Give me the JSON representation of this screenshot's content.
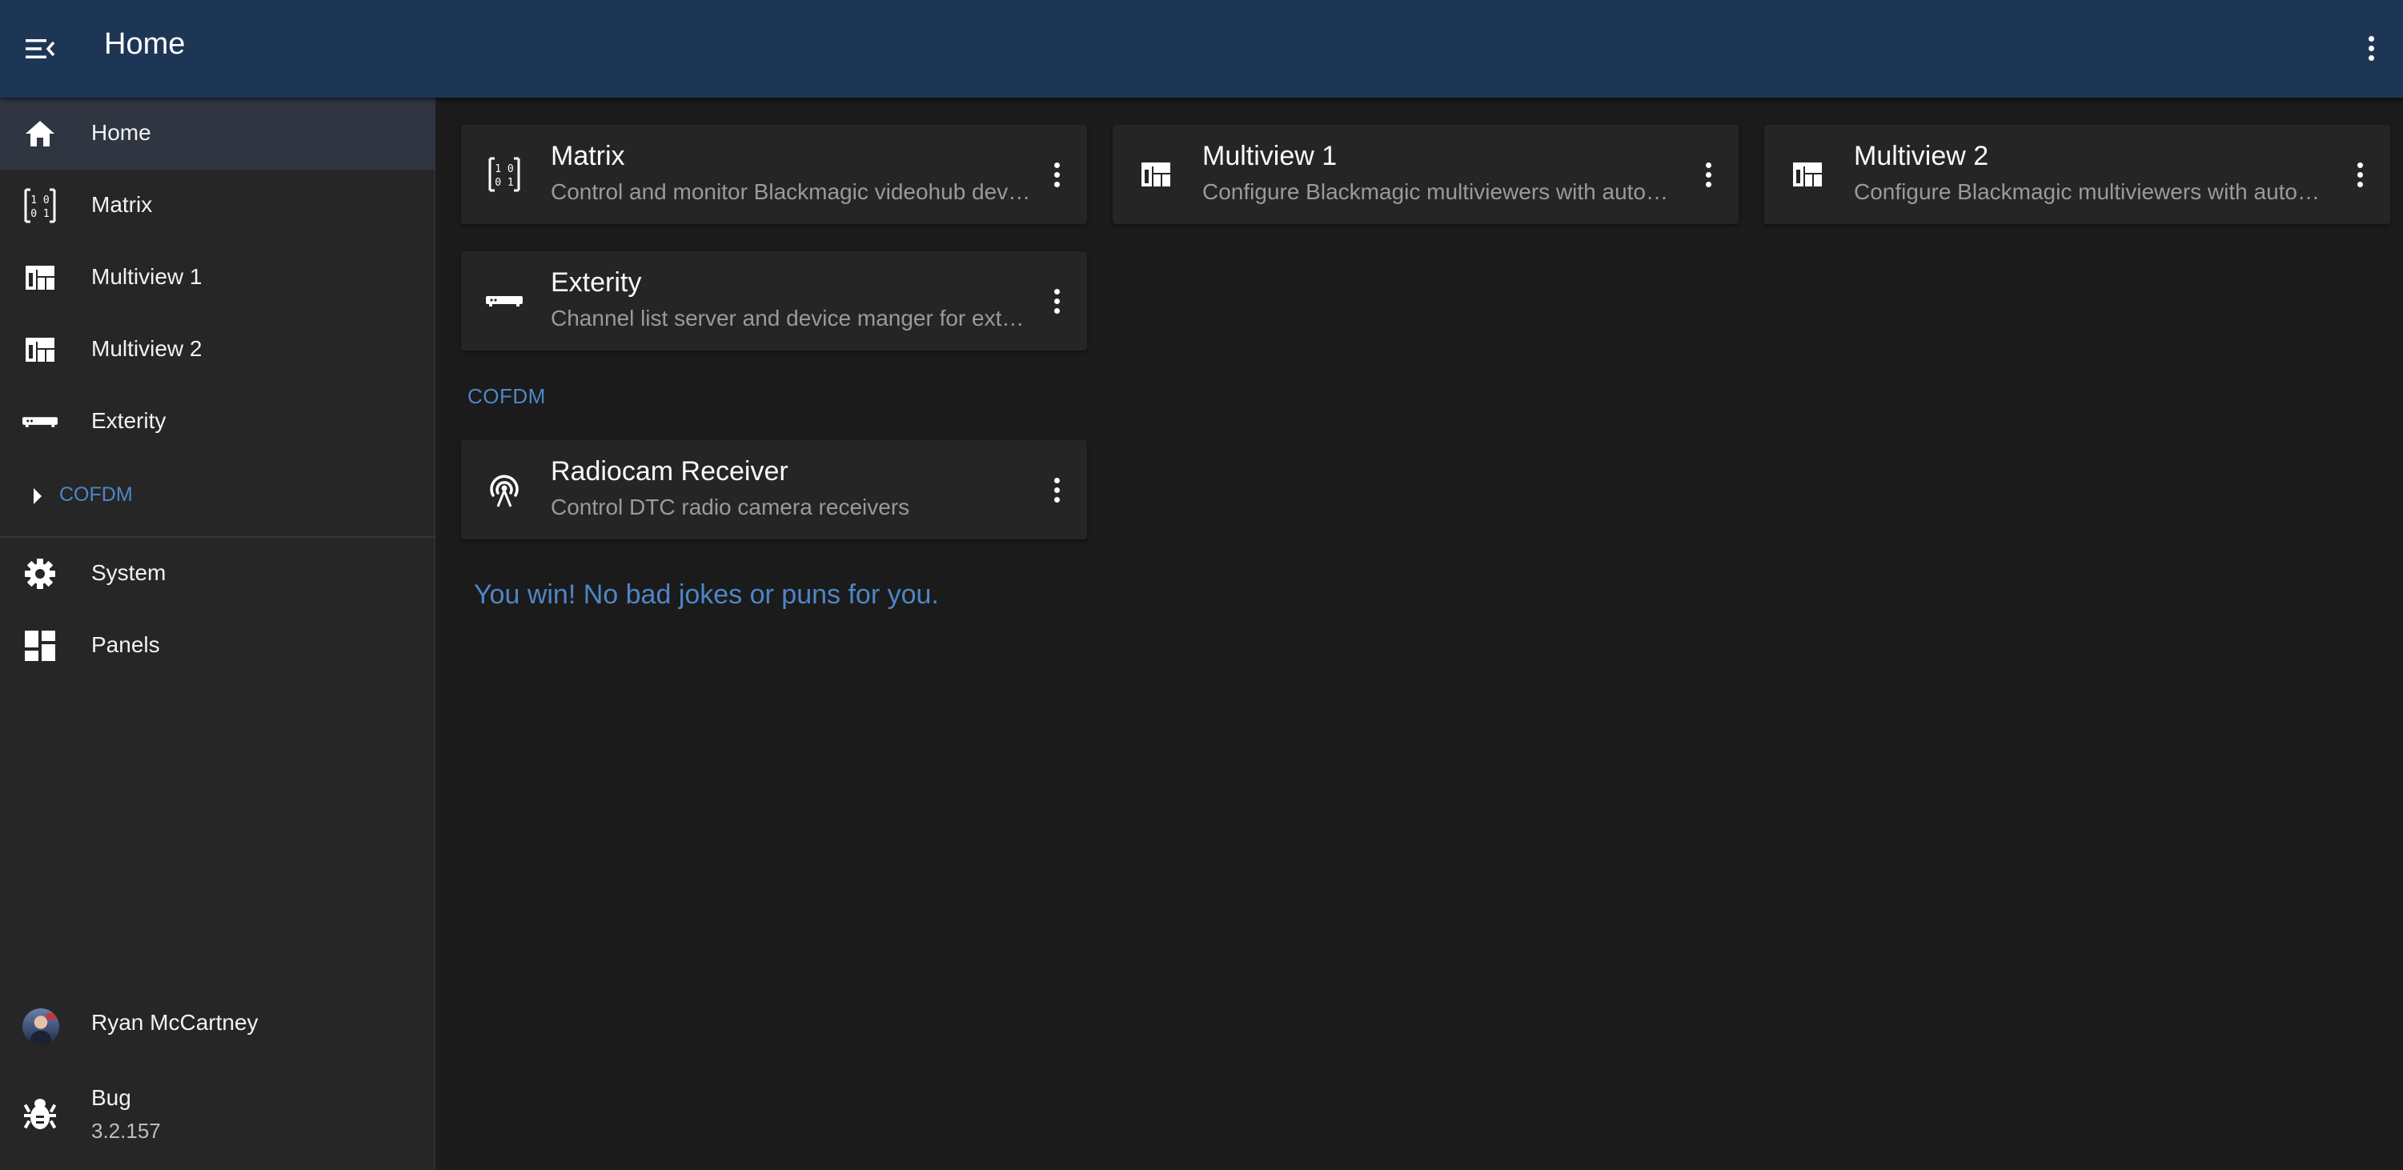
{
  "appbar": {
    "title": "Home",
    "menu_icon": "menu-open-icon",
    "more_icon": "dots-vertical-icon"
  },
  "sidebar": {
    "items": [
      {
        "label": "Home",
        "icon": "home-icon",
        "active": true
      },
      {
        "label": "Matrix",
        "icon": "binary-matrix-icon"
      },
      {
        "label": "Multiview 1",
        "icon": "multiview-icon"
      },
      {
        "label": "Multiview 2",
        "icon": "multiview-icon"
      },
      {
        "label": "Exterity",
        "icon": "set-top-box-icon"
      }
    ],
    "group": {
      "label": "COFDM",
      "icon": "caret-right-icon"
    },
    "bottom_items": [
      {
        "label": "System",
        "icon": "gear-icon"
      },
      {
        "label": "Panels",
        "icon": "dashboard-icon"
      }
    ],
    "user": {
      "name": "Ryan McCartney",
      "icon": "avatar"
    },
    "bug": {
      "label": "Bug",
      "version": "3.2.157",
      "icon": "bug-icon"
    }
  },
  "main": {
    "cards": [
      {
        "title": "Matrix",
        "description": "Control and monitor Blackmagic videohub devices",
        "icon": "binary-matrix-icon"
      },
      {
        "title": "Multiview 1",
        "description": "Configure Blackmagic multiviewers with automatic labels",
        "icon": "multiview-icon"
      },
      {
        "title": "Multiview 2",
        "description": "Configure Blackmagic multiviewers with automatic labels",
        "icon": "multiview-icon"
      },
      {
        "title": "Exterity",
        "description": "Channel list server and device manger for exterity devices",
        "icon": "set-top-box-icon"
      }
    ],
    "section": {
      "label": "COFDM",
      "cards": [
        {
          "title": "Radiocam Receiver",
          "description": "Control DTC radio camera receivers",
          "icon": "access-point-icon"
        }
      ]
    },
    "joke": "You win! No bad jokes or puns for you."
  },
  "colors": {
    "appbar": "#1e3656",
    "sidebar": "#262626",
    "background": "#1b1b1b",
    "card": "#252525",
    "accent": "#4e86c6",
    "active_item": "#2f3642"
  }
}
